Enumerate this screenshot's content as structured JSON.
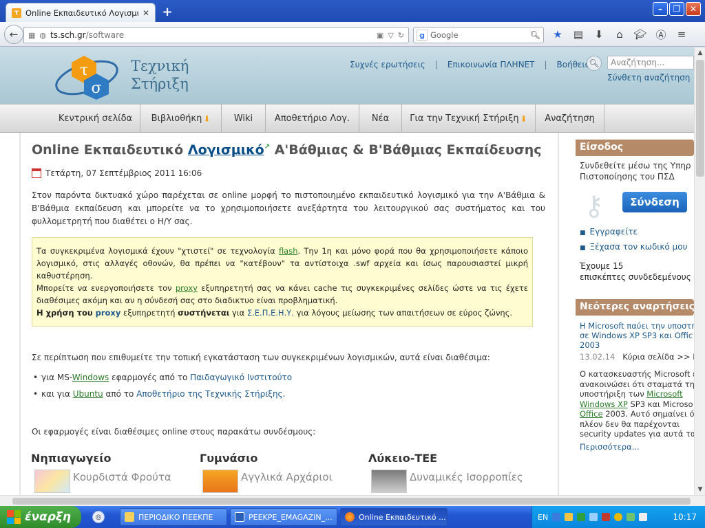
{
  "browser": {
    "tab_title": "Online Εκπαιδευτικό Λογισμικό Α'...",
    "new_tab": "+",
    "url_host": "ts.sch.gr",
    "url_path": "/software",
    "search_placeholder": "Google"
  },
  "site": {
    "logo_line1": "Τεχνική",
    "logo_line2": "Στήριξη",
    "top_links": [
      "Συχνές ερωτήσεις",
      "Επικοινωνία ΠΛΗΝΕΤ",
      "Βοήθεια"
    ],
    "search_placeholder": "Αναζήτηση...",
    "advanced_search": "Σύνθετη αναζήτηση",
    "menu": [
      {
        "label": "Κεντρική σελίδα"
      },
      {
        "label": "Βιβλιοθήκη"
      },
      {
        "label": "Wiki"
      },
      {
        "label": "Αποθετήριο Λογ."
      },
      {
        "label": "Νέα"
      },
      {
        "label": "Για την Τεχνική Στήριξη"
      },
      {
        "label": "Αναζήτηση"
      }
    ]
  },
  "article": {
    "title_pre": "Online Εκπαιδευτικό ",
    "title_kw": "Λογισμικό",
    "title_post": " Α'Βάθμιας & Β'Βάθμιας Εκπαίδευσης",
    "date": "Τετάρτη, 07 Σεπτέμβριος 2011 16:06",
    "intro": "Στον παρόντα δικτυακό χώρο παρέχεται σε online μορφή το πιστοποιημένο εκπαιδευτικό λογισμικό για την Α'Βάθμια & Β'Βάθμια εκπαίδευση και μπορείτε να το χρησιμοποιήσετε ανεξάρτητα του λειτουργικού σας συστήματος και του φυλλομετρητή που διαθέτει ο Η/Υ σας.",
    "notice": {
      "p1_a": "Τα συγκεκριμένα λογισμικά έχουν \"χτιστεί\" σε τεχνολογία ",
      "p1_link": "flash",
      "p1_b": ". Την 1η και μόνο φορά που θα χρησιμοποιήσετε κάποιο λογισμικό, στις αλλαγές οθονών, θα πρέπει να \"κατέβουν\" τα αντίστοιχα .swf αρχεία και ίσως παρουσιαστεί μικρή καθυστέρηση.",
      "p2_a": "Μπορείτε να ενεργοποιήσετε τον ",
      "p2_link": "proxy",
      "p2_b": " εξυπηρετητή σας να κάνει cache τις συγκεκριμένες σελίδες ώστε να τις έχετε διαθέσιμες ακόμη και αν η σύνδεσή σας στο διαδικτυο είναι προβληματική.",
      "p3_a": "Η χρήση του ",
      "p3_link": "proxy",
      "p3_b": " εξυπηρετητή ",
      "p3_c": "συστήνεται",
      "p3_d": " για ",
      "p3_link2": "Σ.Ε.Π.Ε.Η.Υ.",
      "p3_e": " για λόγους μείωσης των απαιτήσεων σε εύρος ζώνης."
    },
    "available": "Σε περίπτωση που επιθυμείτε την τοπική εγκατάσταση των συγκεκριμένων λογισμικών, αυτά είναι διαθέσιμα:",
    "bullet1_a": "για MS-",
    "bullet1_link": "Windows",
    "bullet1_b": " εφαρμογές από το ",
    "bullet1_link2": "Παιδαγωγικό Ινστιτούτο",
    "bullet2_a": "και για ",
    "bullet2_link": "Ubuntu",
    "bullet2_b": " από το ",
    "bullet2_link2": "Αποθετήριο της Τεχνικής Στήριξης",
    "bullet2_c": ".",
    "online_apps": "Οι εφαρμογές είναι διαθέσιμες online στους παρακάτω συνδέσμους:",
    "categories": [
      {
        "name": "Νηπιαγωγείο",
        "app": "Κουρδιστά Φρούτα"
      },
      {
        "name": "Γυμνάσιο",
        "app": "Αγγλικά Αρχάριοι"
      },
      {
        "name": "Λύκειο-ΤΕΕ",
        "app": "Δυναμικές Ισορροπίες"
      }
    ]
  },
  "sidebar": {
    "login_head": "Είσοδος",
    "login_text1": "Συνδεθείτε μέσω της Υπηρ",
    "login_text2": "Πιστοποίησης του ΠΣΔ",
    "login_button": "Σύνδεση",
    "register": "Εγγραφείτε",
    "forgot": "Ξέχασα τον κωδικό μου",
    "visitors1": "Έχουμε 15",
    "visitors2": "επισκέπτες συνδεδεμένους",
    "news_head": "Νεότερες αναρτήσεις",
    "news_title1": "Η Microsoft παύει την υποστή",
    "news_title2": "σε Windows XP SP3 και Offic",
    "news_title3": "2003",
    "news_date": "13.02.14",
    "news_cat": "Κύρια σελίδα >> Ν",
    "news_body1": "Ο κατασκευαστής Microsoft έ",
    "news_body2": "ανακοινώσει ότι σταματά την",
    "news_body3": "υποστήριξη των ",
    "news_link1": "Microsoft",
    "news_link2": "Windows XP",
    "news_body4": " SP3 και Microso",
    "news_link3": "Office",
    "news_body5": " 2003. Αυτό σημαίνει ό",
    "news_body6": "πλέον δεν θα παρέχονται",
    "news_body7": "security updates για αυτά τα",
    "more": "Περισσότερα..."
  },
  "taskbar": {
    "start": "έναρξη",
    "items": [
      {
        "label": "ΠΕΡΙΟΔΙΚΟ ΠΕΕΚΠΕ"
      },
      {
        "label": "PEEKPE_EMAGAZIN_..."
      },
      {
        "label": "Online Εκπαιδευτικό ..."
      }
    ],
    "lang": "EN",
    "clock": "10:17"
  },
  "colors": {
    "accent": "#1f5a8a",
    "header_bg": "#b7d0db",
    "sidebar_head": "#b48a68",
    "notice_bg": "#fefcd0",
    "start_green": "#3a9a36"
  },
  "icons": [
    "back-arrow-icon",
    "star-icon",
    "reader-icon",
    "download-icon",
    "home-icon",
    "menu-icon",
    "search-icon",
    "calendar-icon",
    "key-icon",
    "windows-flag-icon"
  ]
}
